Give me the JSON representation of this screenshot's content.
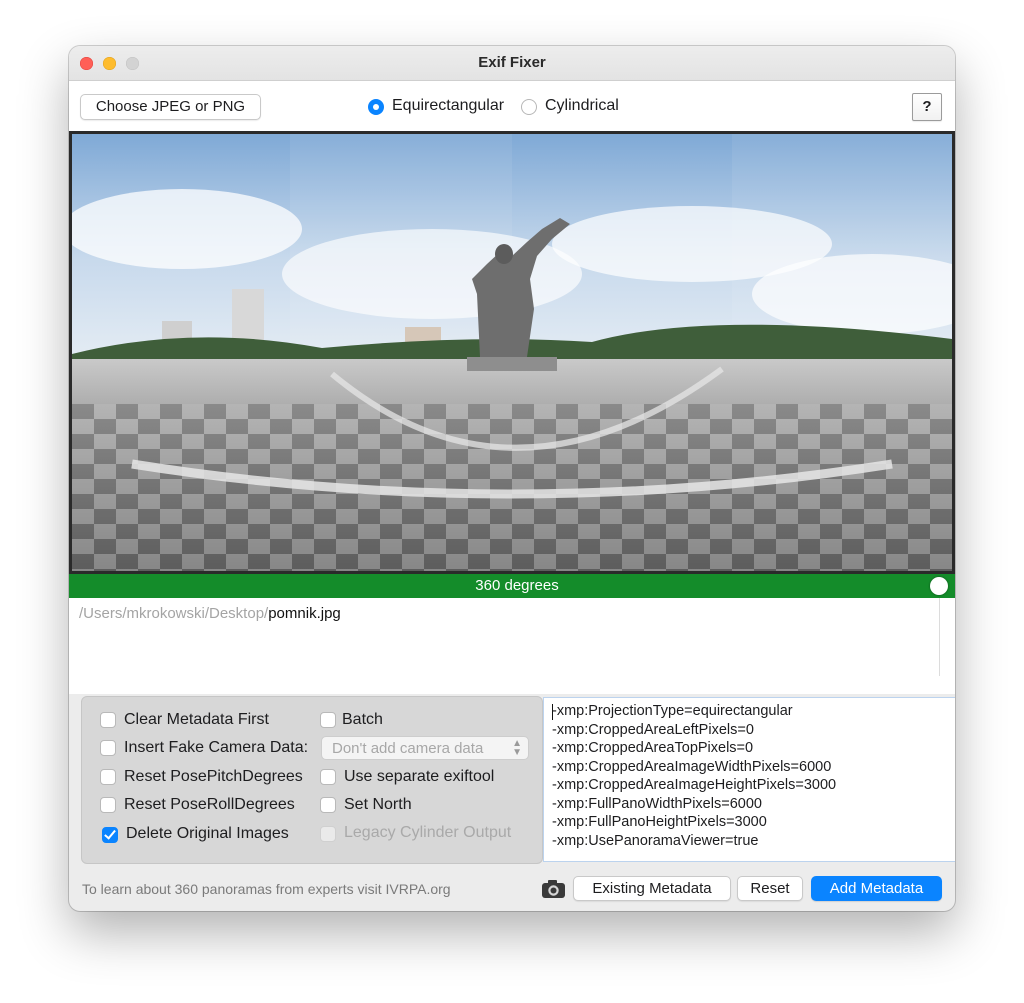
{
  "window": {
    "title": "Exif Fixer"
  },
  "toolbar": {
    "choose_button": "Choose JPEG or PNG",
    "projection_options": [
      {
        "label": "Equirectangular",
        "selected": true
      },
      {
        "label": "Cylindrical",
        "selected": false
      }
    ],
    "help_button": "?"
  },
  "pano": {
    "image_alt": "equirectangular panorama of a statue on a checkered plaza",
    "degrees_label": "360 degrees",
    "bar_color": "#148c2a",
    "slider_value_percent": 100
  },
  "path": {
    "directory": "/Users/mkrokowski/Desktop/",
    "file": "pomnik.jpg"
  },
  "options": {
    "clear_metadata": {
      "label": "Clear Metadata First",
      "checked": false
    },
    "batch": {
      "label": "Batch",
      "checked": false
    },
    "insert_fake_camera": {
      "label": "Insert Fake Camera Data:",
      "checked": false
    },
    "camera_select": {
      "value": "Don't add camera data"
    },
    "reset_pitch": {
      "label": "Reset PosePitchDegrees",
      "checked": false
    },
    "separate_exiftool": {
      "label": "Use separate exiftool",
      "checked": false
    },
    "reset_roll": {
      "label": "Reset PoseRollDegrees",
      "checked": false
    },
    "set_north": {
      "label": "Set North",
      "checked": false
    },
    "delete_originals": {
      "label": "Delete Original Images",
      "checked": true
    },
    "legacy_cylinder": {
      "label": "Legacy Cylinder Output",
      "checked": false,
      "disabled": true
    }
  },
  "metadata_lines": [
    "-xmp:ProjectionType=equirectangular",
    "-xmp:CroppedAreaLeftPixels=0",
    "-xmp:CroppedAreaTopPixels=0",
    "-xmp:CroppedAreaImageWidthPixels=6000",
    "-xmp:CroppedAreaImageHeightPixels=3000",
    "-xmp:FullPanoWidthPixels=6000",
    "-xmp:FullPanoHeightPixels=3000",
    "-xmp:UsePanoramaViewer=true"
  ],
  "footer": {
    "info_text": "To learn about 360 panoramas from experts visit IVRPA.org",
    "camera_icon": "camera-icon",
    "existing_button": "Existing Metadata",
    "reset_button": "Reset",
    "add_button": "Add Metadata",
    "accent_color": "#0a84ff"
  }
}
